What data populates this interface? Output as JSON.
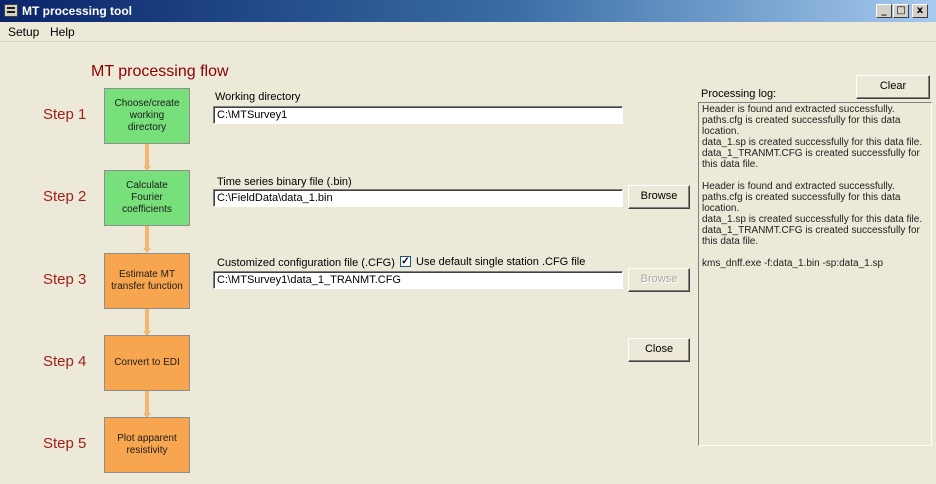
{
  "window": {
    "title": "MT processing tool",
    "minimize_glyph": "_",
    "maximize_glyph": "□",
    "close_glyph": "x"
  },
  "menu": [
    "Setup",
    "Help"
  ],
  "flow_title": "MT processing flow",
  "steps": [
    {
      "label": "Step 1",
      "box": "Choose/create working directory",
      "status": "done",
      "color": "#78e07a"
    },
    {
      "label": "Step 2",
      "box": "Calculate Fourier coefficients",
      "status": "done",
      "color": "#78e07a"
    },
    {
      "label": "Step 3",
      "box": "Estimate MT transfer function",
      "status": "pending",
      "color": "#f7a64f"
    },
    {
      "label": "Step 4",
      "box": "Convert to EDI",
      "status": "pending",
      "color": "#f7a64f"
    },
    {
      "label": "Step 5",
      "box": "Plot apparent resistivity",
      "status": "pending",
      "color": "#f7a64f"
    }
  ],
  "fields": {
    "working_dir": {
      "label": "Working directory",
      "value": "C:\\MTSurvey1"
    },
    "binary_file": {
      "label": "Time series binary file (.bin)",
      "value": "C:\\FieldData\\data_1.bin"
    },
    "config_file": {
      "label": "Customized configuration file (.CFG)",
      "value": "C:\\MTSurvey1\\data_1_TRANMT.CFG"
    }
  },
  "checkbox": {
    "label": "Use default single station .CFG file",
    "checked": true,
    "mark": "✓"
  },
  "buttons": {
    "browse_bin": "Browse",
    "browse_cfg": "Browse",
    "close": "Close",
    "clear": "Clear"
  },
  "log": {
    "label": "Processing log:",
    "lines": [
      "Header is found and extracted successfully.",
      "paths.cfg is created successfully for this data location.",
      "data_1.sp is created successfully for this data file.",
      "data_1_TRANMT.CFG is created successfully for this data file.",
      "",
      "Header is found and extracted successfully.",
      "paths.cfg is created successfully for this data location.",
      "data_1.sp is created successfully for this data file.",
      "data_1_TRANMT.CFG is created successfully for this data file.",
      "",
      "kms_dnff.exe -f:data_1.bin -sp:data_1.sp"
    ]
  }
}
